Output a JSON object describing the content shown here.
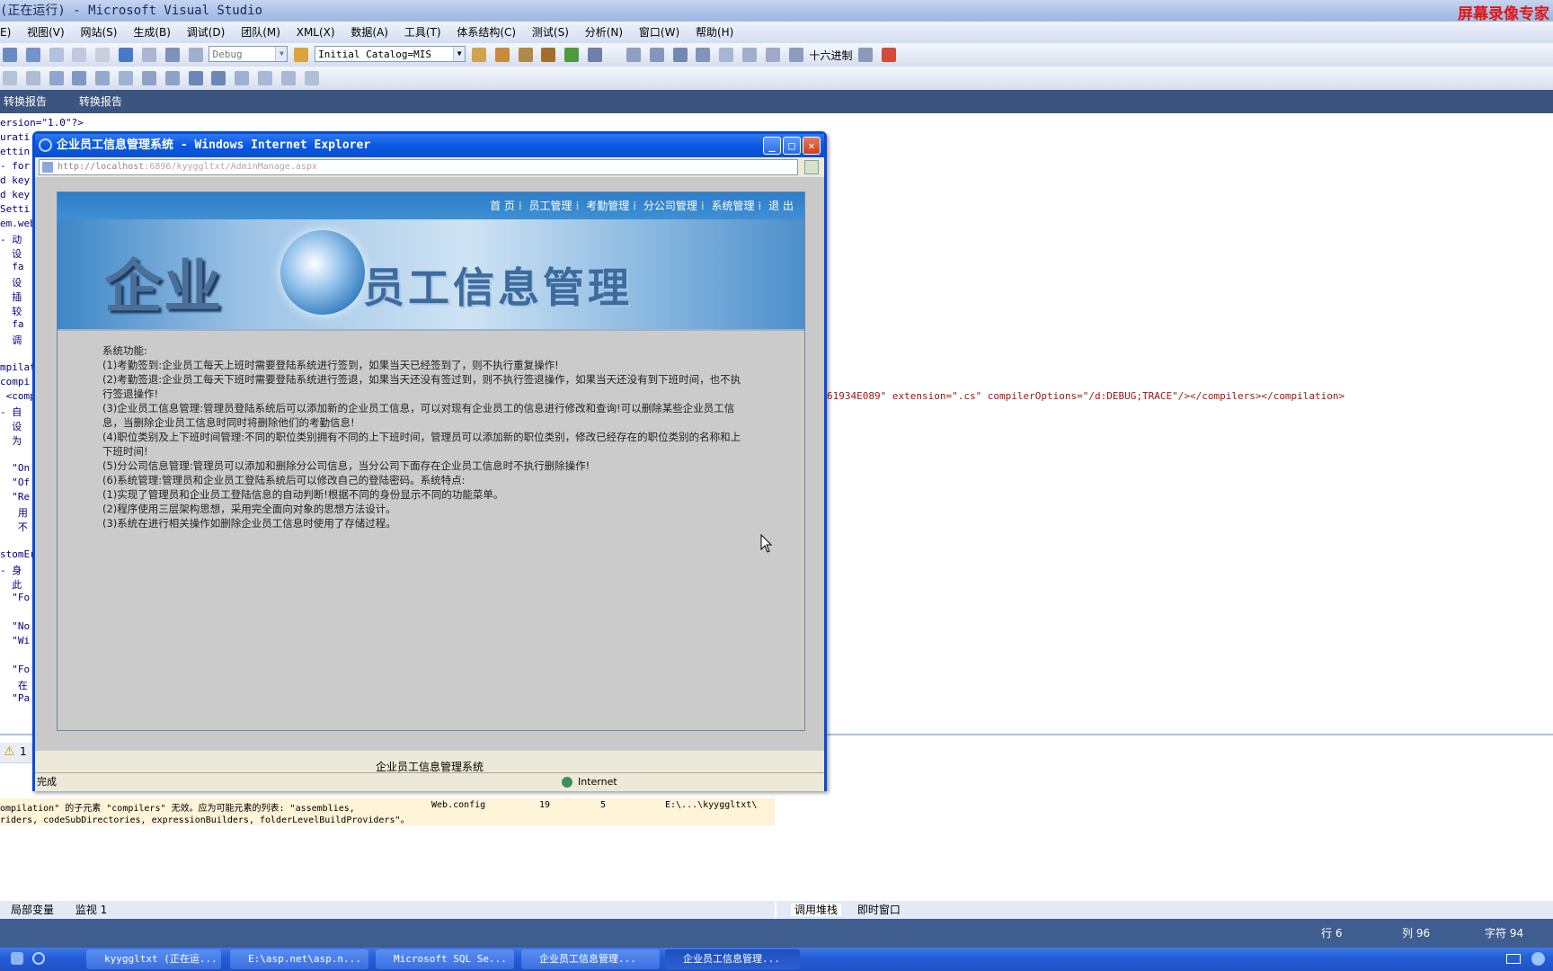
{
  "vs": {
    "title": "(正在运行) - Microsoft Visual Studio",
    "recorder_label": "屏幕录像专家",
    "menu": [
      "E)",
      "视图(V)",
      "网站(S)",
      "生成(B)",
      "调试(D)",
      "团队(M)",
      "XML(X)",
      "数据(A)",
      "工具(T)",
      "体系结构(C)",
      "测试(S)",
      "分析(N)",
      "窗口(W)",
      "帮助(H)"
    ],
    "config_combo": "Debug",
    "connection_combo": "Initial Catalog=MIS",
    "hex_label": "十六进制",
    "doc_tabs": [
      "转换报告",
      "转换报告"
    ],
    "code_lines": [
      "ersion=\"1.0\"?>",
      "urati",
      "ettin",
      "- for",
      "d key",
      "d key",
      "Setti",
      "em.web",
      "- 动",
      "  设",
      "  fa",
      "  设",
      "  插",
      "  较",
      "  fa",
      "  调",
      "",
      "mpilat",
      "compi",
      " <comp",
      "- 自",
      "  设",
      "  为",
      "",
      "  \"On",
      "  \"Of",
      "  \"Re",
      "   用",
      "   不",
      "",
      "stomEr",
      "- 身",
      "  此",
      "  \"Fo",
      "",
      "  \"No",
      "  \"Wi",
      "",
      "  \"Fo",
      "   在",
      "  \"Pa"
    ],
    "code_right": "61934E089\" extension=\".cs\" compilerOptions=\"/d:DEBUG;TRACE\"/></compilers></compilation>",
    "error_tab_count": "1",
    "error_message_line1": "ompilation\" 的子元素 \"compilers\" 无效。应为可能元素的列表: \"assemblies,",
    "error_message_line2": "riders, codeSubDirectories, expressionBuilders, folderLevelBuildProviders\"。",
    "error_file": "Web.config",
    "error_line": "19",
    "error_col": "5",
    "error_project": "E:\\...\\kyyggltxt\\",
    "panel_tabs_left": [
      "局部变量",
      "监视 1"
    ],
    "panel_tabs_right": [
      "调用堆栈",
      "即时窗口"
    ],
    "status_row": "行 6",
    "status_col": "列 96",
    "status_char": "字符 94"
  },
  "taskbar": {
    "tasks": [
      "kyyggltxt (正在运...",
      "E:\\asp.net\\asp.n...",
      "Microsoft SQL Se...",
      "企业员工信息管理...",
      "企业员工信息管理..."
    ]
  },
  "ie": {
    "title": "企业员工信息管理系统 - Windows Internet Explorer",
    "url_host": "http://localhost",
    "url_rest": ":6896/kyyggltxt/AdminManage.aspx",
    "status_done": "完成",
    "zone": "Internet"
  },
  "site": {
    "nav": [
      "首 页",
      "员工管理",
      "考勤管理",
      "分公司管理",
      "系统管理",
      "退 出"
    ],
    "banner_left": "企业",
    "banner_right": "员工信息管理",
    "functions": [
      "系统功能:",
      "  (1)考勤签到:企业员工每天上班时需要登陆系统进行签到，如果当天已经签到了，则不执行重复操作!",
      "  (2)考勤签退:企业员工每天下班时需要登陆系统进行签退，如果当天还没有签过到，则不执行签退操作，如果当天还没有到下班时间，也不执行签退操作!",
      "  (3)企业员工信息管理:管理员登陆系统后可以添加新的企业员工信息，可以对现有企业员工的信息进行修改和查询!可以删除某些企业员工信息，当删除企业员工信息时同时将删除他们的考勤信息!",
      "  (4)职位类别及上下班时间管理:不同的职位类别拥有不同的上下班时间，管理员可以添加新的职位类别，修改已经存在的职位类别的名称和上下班时间!",
      "  (5)分公司信息管理:管理员可以添加和删除分公司信息，当分公司下面存在企业员工信息时不执行删除操作!",
      "  (6)系统管理:管理员和企业员工登陆系统后可以修改自己的登陆密码。系统特点:",
      "  (1)实现了管理员和企业员工登陆信息的自动判断!根据不同的身份显示不同的功能菜单。",
      "  (2)程序使用三层架构思想，采用完全面向对象的思想方法设计。",
      "(3)系统在进行相关操作如删除企业员工信息时使用了存储过程。"
    ],
    "footer": "企业员工信息管理系统"
  }
}
